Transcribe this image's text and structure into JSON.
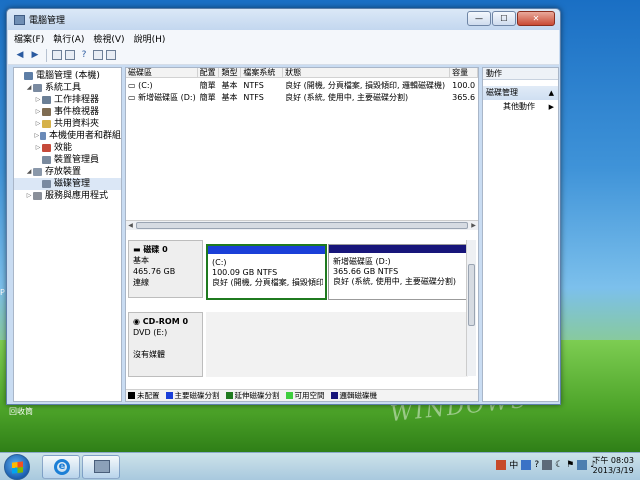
{
  "window": {
    "title": "電腦管理",
    "controls": {
      "minimize": "—",
      "maximize": "☐",
      "close": "✕"
    }
  },
  "menu": [
    "檔案(F)",
    "執行(A)",
    "檢視(V)",
    "說明(H)"
  ],
  "toolbar": [
    "back-arrow-icon",
    "forward-arrow-icon",
    "up-folder-icon",
    "show-hide-tree-icon",
    "help-icon",
    "properties-icon",
    "export-icon"
  ],
  "tree": [
    {
      "label": "電腦管理 (本機)",
      "level": 0,
      "exp": "",
      "color": "#5d7ea6"
    },
    {
      "label": "系統工具",
      "level": 1,
      "exp": "◢",
      "color": "#7a8aa0"
    },
    {
      "label": "工作排程器",
      "level": 2,
      "exp": "▷",
      "color": "#6b7f96"
    },
    {
      "label": "事件檢視器",
      "level": 2,
      "exp": "▷",
      "color": "#7f6c52"
    },
    {
      "label": "共用資料夾",
      "level": 2,
      "exp": "▷",
      "color": "#d6b24a"
    },
    {
      "label": "本機使用者和群組",
      "level": 2,
      "exp": "▷",
      "color": "#6a8ab8"
    },
    {
      "label": "效能",
      "level": 2,
      "exp": "▷",
      "color": "#c64a3a"
    },
    {
      "label": "裝置管理員",
      "level": 2,
      "exp": "",
      "color": "#7a8a9e"
    },
    {
      "label": "存放裝置",
      "level": 1,
      "exp": "◢",
      "color": "#8a98aa"
    },
    {
      "label": "磁碟管理",
      "level": 2,
      "exp": "",
      "color": "#7a8aa0",
      "selected": true
    },
    {
      "label": "服務與應用程式",
      "level": 1,
      "exp": "▷",
      "color": "#8a8f99"
    }
  ],
  "volume_table": {
    "headers": [
      "磁碟區",
      "配置",
      "類型",
      "檔案系統",
      "狀態",
      "容量"
    ],
    "rows": [
      [
        "(C:)",
        "簡單",
        "基本",
        "NTFS",
        "良好 (開機, 分頁檔案, 損毀傾印, 邏輯磁碟機)",
        "100.0"
      ],
      [
        "新增磁碟區 (D:)",
        "簡單",
        "基本",
        "NTFS",
        "良好 (系統, 使用中, 主要磁碟分割)",
        "365.6"
      ]
    ]
  },
  "disks": [
    {
      "name": "磁碟 0",
      "type": "基本",
      "size": "465.76 GB",
      "status": "連線",
      "partitions": [
        {
          "name": "(C:)",
          "size": "100.09 GB NTFS",
          "status": "良好 (開機, 分頁檔案, 損毀傾印",
          "bar": "#1a3fd8",
          "selected": true
        },
        {
          "name": "新增磁碟區 (D:)",
          "size": "365.66 GB NTFS",
          "status": "良好 (系統, 使用中, 主要磁碟分割)",
          "bar": "#17157a",
          "selected": false
        }
      ]
    },
    {
      "name": "CD-ROM 0",
      "type": "DVD (E:)",
      "status": "沒有媒體"
    }
  ],
  "legend": [
    {
      "label": "未配置",
      "color": "#000000"
    },
    {
      "label": "主要磁碟分割",
      "color": "#1a3fd8"
    },
    {
      "label": "延伸磁碟分割",
      "color": "#1f7a1f"
    },
    {
      "label": "可用空間",
      "color": "#3fcf3f"
    },
    {
      "label": "邏輯磁碟機",
      "color": "#17157a"
    }
  ],
  "actions": {
    "header": "動作",
    "section": "磁碟管理",
    "item": "其他動作"
  },
  "desktop": {
    "label": "回收筒"
  },
  "taskbar": {
    "time": "下午 08:03",
    "date": "2013/3/19",
    "tray": [
      "中",
      "ime-icon",
      "help-icon",
      "keyboard-icon",
      "moon-icon",
      "flag-icon",
      "network-icon",
      "volume-icon"
    ]
  }
}
